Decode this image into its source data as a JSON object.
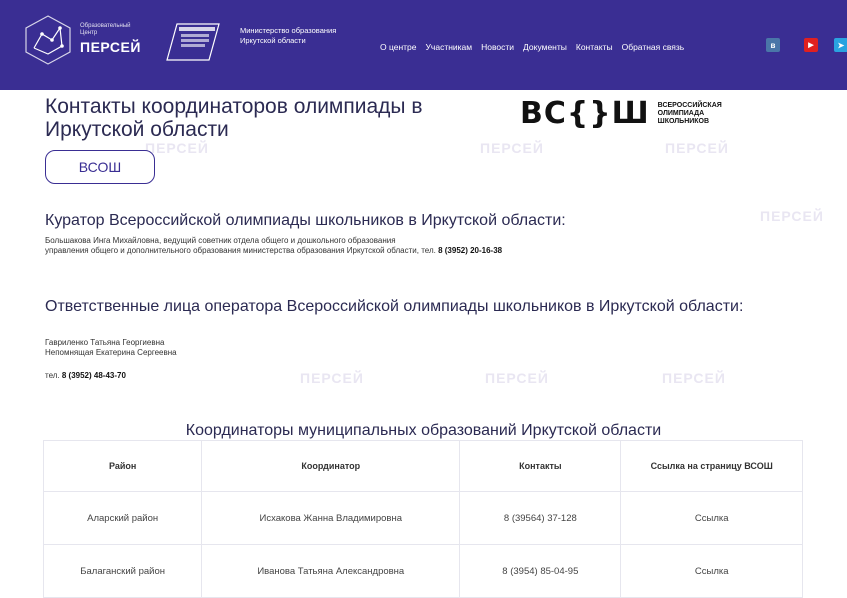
{
  "header": {
    "logo_small": "Образовательный\nЦентр",
    "logo_big": "ПЕРСЕЙ",
    "ministry": "Министерство образования Иркутской области",
    "nav": [
      "О центре",
      "Участникам",
      "Новости",
      "Документы",
      "Контакты",
      "Обратная связь"
    ],
    "social": [
      {
        "name": "vk",
        "label": "в",
        "color": "#4a76a8"
      },
      {
        "name": "youtube",
        "label": "▶",
        "color": "#e02020"
      },
      {
        "name": "telegram",
        "label": "➤",
        "color": "#2aa3e0"
      }
    ]
  },
  "page": {
    "title": "Контакты координаторов олимпиады в Иркутской области",
    "vsosh_logo": "ВС{}Ш",
    "vsosh_sub": "ВСЕРОССИЙСКАЯ ОЛИМПИАДА ШКОЛЬНИКОВ",
    "vsosh_button": "ВСОШ"
  },
  "curator": {
    "heading": "Куратор Всероссийской олимпиады школьников в Иркутской области:",
    "line1": "Большакова Инга Михайловна, ведущий советник отдела общего и дошкольного образования",
    "line2": "управления общего и дополнительного образования министерства образования Иркутской области, тел. ",
    "phone": "8 (3952) 20-16-38"
  },
  "operators": {
    "heading": "Ответственные лица оператора Всероссийской олимпиады школьников в Иркутской области:",
    "person1": "Гавриленко Татьяна Георгиевна",
    "person2": "Непомнящая Екатерина Сергеевна",
    "phone_label": "тел. ",
    "phone": "8 (3952) 48-43-70"
  },
  "table": {
    "title": "Координаторы муниципальных образований Иркутской области",
    "headers": [
      "Район",
      "Координатор",
      "Контакты",
      "Ссылка на страницу ВСОШ"
    ],
    "rows": [
      {
        "district": "Аларский район",
        "coordinator": "Исхакова Жанна Владимировна",
        "contact": "8 (39564) 37-128",
        "link": "Ссылка"
      },
      {
        "district": "Балаганский район",
        "coordinator": "Иванова Татьяна Александровна",
        "contact": "8 (3954) 85-04-95",
        "link": "Ссылка"
      }
    ]
  },
  "watermark": "ПЕРСЕЙ"
}
